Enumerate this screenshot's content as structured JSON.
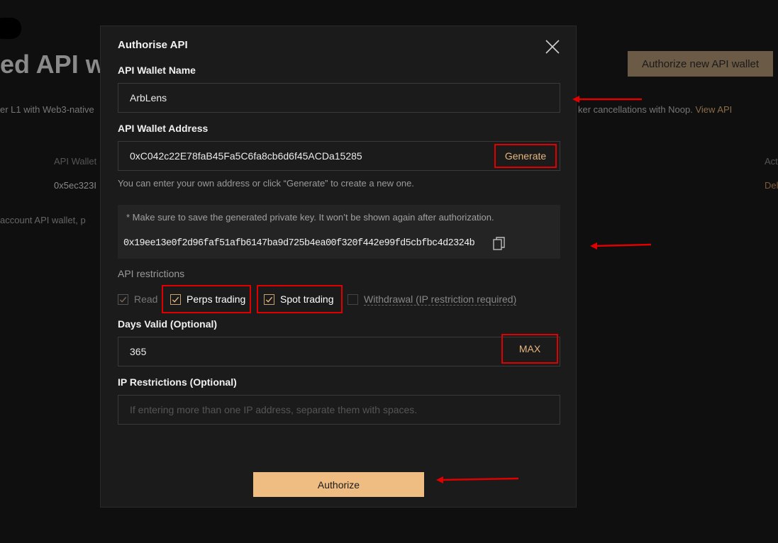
{
  "background": {
    "title": "ed API wa",
    "desc_left": "er L1 with Web3-native",
    "desc_right": "ker cancellations with Noop.",
    "desc_link": "View API",
    "col_head": "API Wallet",
    "addr": "0x5ec323I",
    "note": "account API wallet, p",
    "action_head": "Act",
    "action_delete": "Del",
    "authorize_new_label": "Authorize new API wallet"
  },
  "modal": {
    "title": "Authorise API",
    "name_label": "API Wallet Name",
    "name_value": "ArbLens",
    "address_label": "API Wallet Address",
    "address_value": "0xC042c22E78faB45Fa5C6fa8cb6d6f45ACDa15285",
    "generate_label": "Generate",
    "address_hint": "You can enter your own address or click “Generate” to create a new one.",
    "key_warning": "*  Make sure to save the generated private key. It won’t be shown again after authorization.",
    "private_key": "0x19ee13e0f2d96faf51afb6147ba9d725b4ea00f320f442e99fd5cbfbc4d2324b",
    "restrictions_label": "API restrictions",
    "restrictions": [
      {
        "label": "Read",
        "checked": true,
        "disabled": true
      },
      {
        "label": "Perps trading",
        "checked": true
      },
      {
        "label": "Spot trading",
        "checked": true
      },
      {
        "label": "Withdrawal (IP restriction required)",
        "checked": false
      }
    ],
    "days_label": "Days Valid (Optional)",
    "days_value": "365",
    "max_label": "MAX",
    "ip_label": "IP Restrictions (Optional)",
    "ip_placeholder": "If entering more than one IP address, separate them with spaces.",
    "authorize_label": "Authorize"
  },
  "colors": {
    "accent": "#efbd82",
    "accent_text": "#e7b57f",
    "annotation_red": "#e00000"
  }
}
